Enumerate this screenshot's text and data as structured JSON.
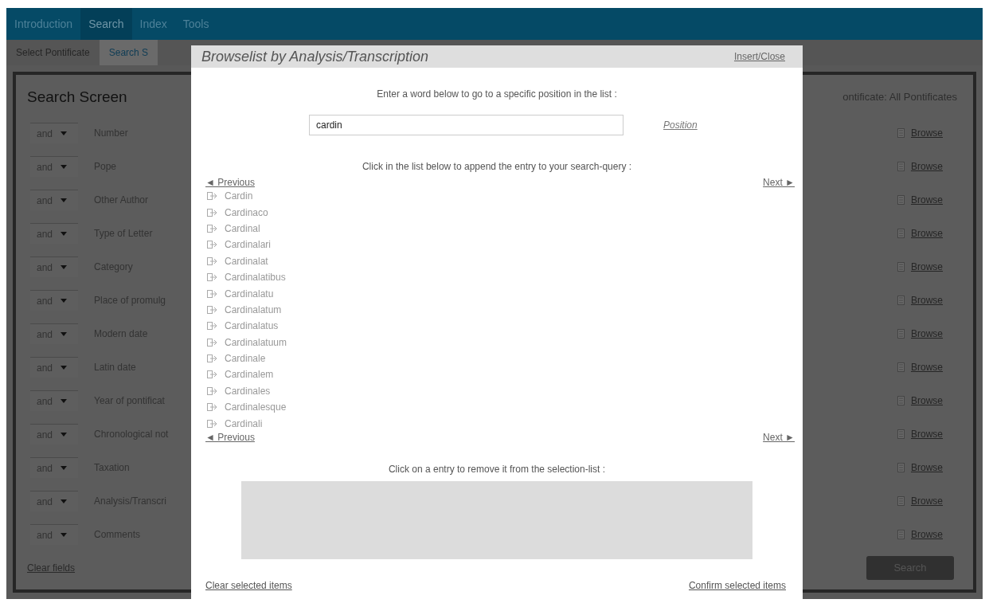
{
  "nav_tabs": [
    {
      "label": "Introduction",
      "selected": false
    },
    {
      "label": "Search",
      "selected": true
    },
    {
      "label": "Index",
      "selected": false
    },
    {
      "label": "Tools",
      "selected": false
    }
  ],
  "sub_tabs": [
    {
      "label": "Select Pontificate",
      "selected": false
    },
    {
      "label": "Search S",
      "selected": true
    }
  ],
  "search_screen": {
    "title": "Search Screen",
    "pontificate": "ontificate: All Pontificates",
    "rows": [
      {
        "operator": "and",
        "field": "Number",
        "browse": "Browse"
      },
      {
        "operator": "and",
        "field": "Pope",
        "browse": "Browse"
      },
      {
        "operator": "and",
        "field": "Other Author",
        "browse": "Browse"
      },
      {
        "operator": "and",
        "field": "Type of Letter",
        "browse": "Browse"
      },
      {
        "operator": "and",
        "field": "Category",
        "browse": "Browse"
      },
      {
        "operator": "and",
        "field": "Place of promulg",
        "browse": "Browse"
      },
      {
        "operator": "and",
        "field": "Modern date",
        "browse": "Browse"
      },
      {
        "operator": "and",
        "field": "Latin date",
        "browse": "Browse"
      },
      {
        "operator": "and",
        "field": "Year of pontificat",
        "browse": "Browse"
      },
      {
        "operator": "and",
        "field": "Chronological not",
        "browse": "Browse"
      },
      {
        "operator": "and",
        "field": "Taxation",
        "browse": "Browse"
      },
      {
        "operator": "and",
        "field": "Analysis/Transcri",
        "browse": "Browse"
      },
      {
        "operator": "and",
        "field": "Comments",
        "browse": "Browse"
      }
    ],
    "clear_link": "Clear fields",
    "search_button": "Search"
  },
  "dialog": {
    "title": "Browselist by Analysis/Transcription",
    "close_link": "Insert/Close",
    "position_hint": "Enter a word below to go to a specific position in the list :",
    "position_value": "cardin",
    "position_link": "Position",
    "list_hint": "Click in the list below to append the entry to your search-query :",
    "previous_top": "◄ Previous",
    "next_top": "Next ►",
    "entries": [
      "Cardin",
      "Cardinaco",
      "Cardinal",
      "Cardinalari",
      "Cardinalat",
      "Cardinalatibus",
      "Cardinalatu",
      "Cardinalatum",
      "Cardinalatus",
      "Cardinalatuum",
      "Cardinale",
      "Cardinalem",
      "Cardinales",
      "Cardinalesque",
      "Cardinali"
    ],
    "previous_bottom": "◄ Previous",
    "next_bottom": "Next ►",
    "selection_hint": "Click on a entry to remove it from the selection-list :",
    "clear_selected": "Clear selected items",
    "confirm_selected": "Confirm selected items"
  }
}
